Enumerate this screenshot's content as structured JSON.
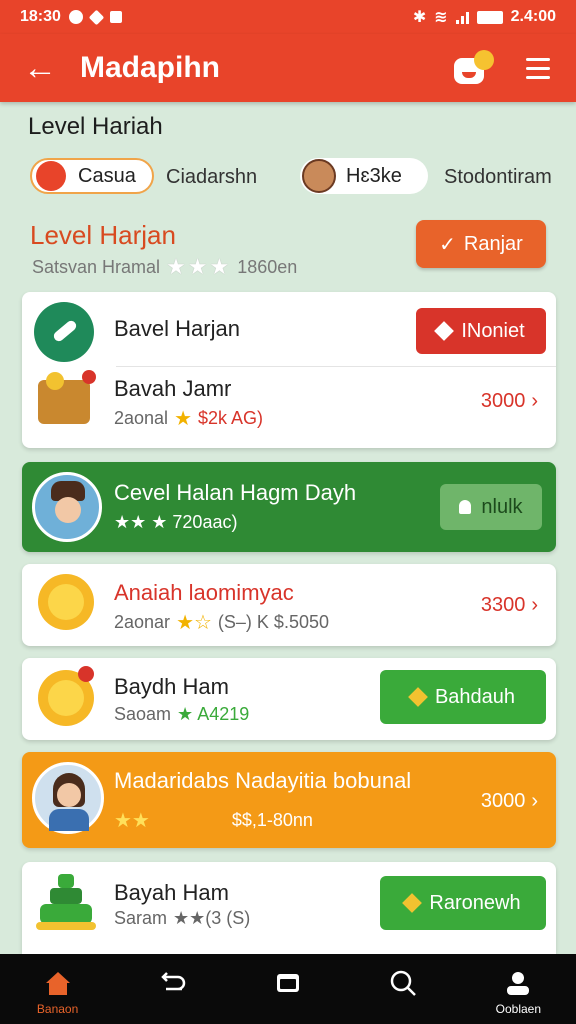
{
  "status": {
    "time": "18:30",
    "right_time": "2.4:00"
  },
  "appbar": {
    "title": "Madapihn"
  },
  "section_title": "Level Hariah",
  "filters": {
    "chip_a": "Casua",
    "label_a": "Ciadarshn",
    "chip_b": "Hɛ3ke",
    "label_b": "Stodontiram"
  },
  "featured": {
    "title": "Level Harjan",
    "subtitle": "Satsvan Hramal",
    "stars": "★★★",
    "count": "1860en",
    "button": "Ranjar"
  },
  "items": [
    {
      "name": "Bavel Harjan",
      "action": "INoniet"
    },
    {
      "name": "Bavah Jamr",
      "meta_a": "2aonal",
      "meta_b": "$2k AG)",
      "price": "3000"
    },
    {
      "name": "Cevel Halan Hagm Dayh",
      "meta": "★★ ★ 720aac)",
      "action": "nlulk"
    },
    {
      "name": "Anaiah laomimyac",
      "meta_a": "2aonar",
      "meta_b": "(S‒) K $.5050",
      "price": "3300"
    },
    {
      "name": "Baydh Ham",
      "meta_a": "Saoam",
      "meta_b": "★ A4219",
      "action": "Bahdauh"
    },
    {
      "name": "Madaridabs Nadayitia bobunal",
      "meta": "$$,1-80nn",
      "price": "3000"
    },
    {
      "name": "Bayah Ham",
      "meta_a": "Saram",
      "meta_b": "★★(3 (S)",
      "action": "Raronewh"
    }
  ],
  "bottom_nav": {
    "home": "Banaon",
    "profile": "Ooblaen"
  },
  "colors": {
    "primary": "#e8442a",
    "green": "#3aaa3a",
    "dark_green": "#2f8a34",
    "orange": "#f49a16"
  }
}
